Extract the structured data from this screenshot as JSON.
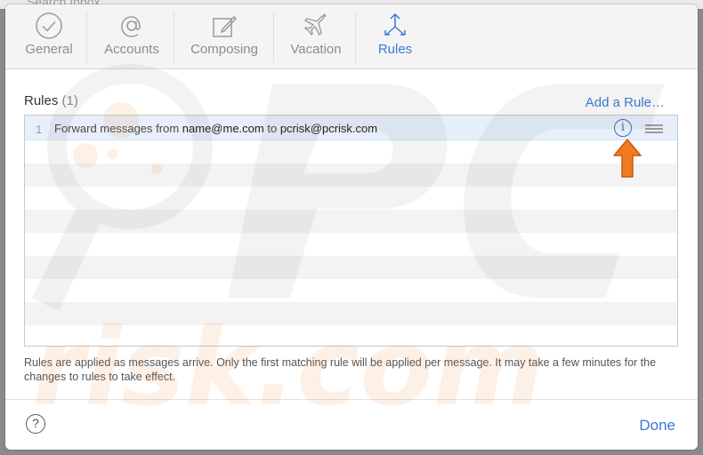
{
  "background": {
    "search_placeholder": "Search Inbox"
  },
  "tabs": [
    {
      "label": "General",
      "icon": "checkmark-circle-icon",
      "active": false
    },
    {
      "label": "Accounts",
      "icon": "at-sign-icon",
      "active": false
    },
    {
      "label": "Composing",
      "icon": "compose-icon",
      "active": false
    },
    {
      "label": "Vacation",
      "icon": "airplane-icon",
      "active": false
    },
    {
      "label": "Rules",
      "icon": "rules-arrows-icon",
      "active": true
    }
  ],
  "rules": {
    "title": "Rules",
    "count": "(1)",
    "add_label": "Add a Rule…",
    "items": [
      {
        "number": "1",
        "prefix": "Forward messages from",
        "from": "name@me.com",
        "connector": "to",
        "to": "pcrisk@pcrisk.com",
        "info_glyph": "i"
      }
    ],
    "footnote": "Rules are applied as messages arrive. Only the first matching rule will be applied per message. It may take a few minutes for the changes to rules to take effect."
  },
  "footer": {
    "help_glyph": "?",
    "done_label": "Done"
  },
  "colors": {
    "accent": "#3a7bd5",
    "arrow": "#f07a20",
    "selected_row": "#e7effb"
  }
}
